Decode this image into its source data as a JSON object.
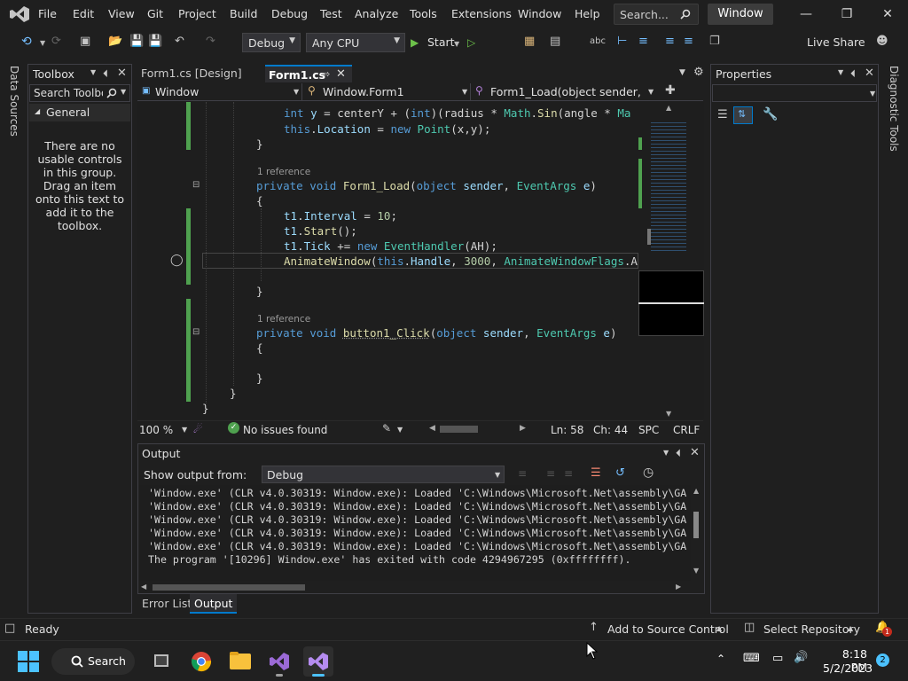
{
  "menu": [
    "File",
    "Edit",
    "View",
    "Git",
    "Project",
    "Build",
    "Debug",
    "Test",
    "Analyze",
    "Tools",
    "Extensions",
    "Window",
    "Help"
  ],
  "search": {
    "placeholder": "Search..."
  },
  "title": "Window",
  "toolbar": {
    "config": "Debug",
    "platform": "Any CPU",
    "start_label": "Start",
    "live_share": "Live Share"
  },
  "left_rail": {
    "data_sources": "Data Sources"
  },
  "right_rail": {
    "diagnostic_tools": "Diagnostic Tools"
  },
  "toolbox": {
    "title": "Toolbox",
    "search_placeholder": "Search Toolbox",
    "group": "General",
    "empty_text": [
      "There are no",
      "usable controls",
      "in this group.",
      "Drag an item",
      "onto this text to",
      "add it to the",
      "toolbox."
    ]
  },
  "tabs": [
    {
      "label": "Form1.cs [Design]"
    },
    {
      "label": "Form1.cs"
    }
  ],
  "nav": {
    "project": "Window",
    "class": "Window.Form1",
    "member": "Form1_Load(object sender, E"
  },
  "code": {
    "line1_part1": "int y = centerY + (",
    "line1_part2": "int",
    "line1_part3": ")(radius * ",
    "line1_part4": "Math",
    "line1_part5": ".Sin(angle * Ma",
    "ref1": "1 reference",
    "ref2": "1 reference"
  },
  "editor_status": {
    "zoom": "100 %",
    "issues": "No issues found",
    "ln": "Ln: 58",
    "ch": "Ch: 44",
    "spc": "SPC",
    "crlf": "CRLF"
  },
  "output": {
    "title": "Output",
    "show_from_label": "Show output from:",
    "source": "Debug",
    "lines": [
      "'Window.exe' (CLR v4.0.30319: Window.exe): Loaded 'C:\\Windows\\Microsoft.Net\\assembly\\GA",
      "'Window.exe' (CLR v4.0.30319: Window.exe): Loaded 'C:\\Windows\\Microsoft.Net\\assembly\\GA",
      "'Window.exe' (CLR v4.0.30319: Window.exe): Loaded 'C:\\Windows\\Microsoft.Net\\assembly\\GA",
      "'Window.exe' (CLR v4.0.30319: Window.exe): Loaded 'C:\\Windows\\Microsoft.Net\\assembly\\GA",
      "'Window.exe' (CLR v4.0.30319: Window.exe): Loaded 'C:\\Windows\\Microsoft.Net\\assembly\\GA",
      "The program '[10296] Window.exe' has exited with code 4294967295 (0xffffffff)."
    ]
  },
  "bottom_tabs": [
    "Error List",
    "Output"
  ],
  "properties": {
    "title": "Properties"
  },
  "status": {
    "ready": "Ready",
    "add_source": "Add to Source Control",
    "select_repo": "Select Repository",
    "notif_count": "1"
  },
  "taskbar": {
    "search": "Search",
    "time": "8:18 PM",
    "date": "5/2/2023",
    "badge": "2"
  },
  "colors": {
    "accent": "#007acc",
    "green_bar": "#4fa14f",
    "bg": "#1f1f1f"
  }
}
